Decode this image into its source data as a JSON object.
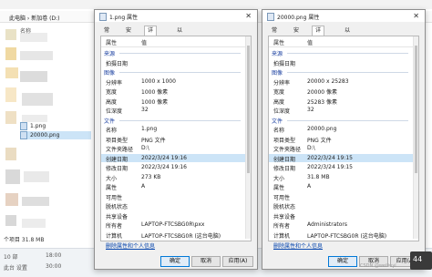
{
  "explorer": {
    "title": "",
    "breadcrumb": "此电脑 › 新加卷 (D:)",
    "column_name": "名称",
    "files": [
      {
        "name": "1.png",
        "selected": false
      },
      {
        "name": "20000.png",
        "selected": true
      }
    ],
    "status": "个项目  31.8 MB",
    "bottom_left_1": "10 部",
    "bottom_left_2": "此台 设置",
    "bottom_times": [
      "18:00",
      "30:00"
    ],
    "tray_text": "44"
  },
  "dialog1": {
    "title": "1.png 属性",
    "tabs": [
      "常规",
      "安全",
      "详细信息",
      "以前的版本"
    ],
    "active_tab": "详细信息",
    "header_property": "属性",
    "header_value": "值",
    "rows": [
      {
        "k": "来源",
        "v": "",
        "section": true
      },
      {
        "k": "拍摄日期",
        "v": ""
      },
      {
        "k": "图像",
        "v": "",
        "section": true
      },
      {
        "k": "分辨率",
        "v": "1000 x 1000"
      },
      {
        "k": "宽度",
        "v": "1000 像素"
      },
      {
        "k": "高度",
        "v": "1000 像素"
      },
      {
        "k": "位深度",
        "v": "32"
      },
      {
        "k": "文件",
        "v": "",
        "section": true
      },
      {
        "k": "名称",
        "v": "1.png"
      },
      {
        "k": "项目类型",
        "v": "PNG 文件"
      },
      {
        "k": "文件夹路径",
        "v": "D:\\"
      },
      {
        "k": "创建日期",
        "v": "2022/3/24 19:16",
        "hl": true
      },
      {
        "k": "修改日期",
        "v": "2022/3/24 19:16"
      },
      {
        "k": "大小",
        "v": "273 KB"
      },
      {
        "k": "属性",
        "v": "A"
      },
      {
        "k": "可用性",
        "v": ""
      },
      {
        "k": "脱机状态",
        "v": ""
      },
      {
        "k": "共享设备",
        "v": ""
      },
      {
        "k": "所有者",
        "v": "LAPTOP-FTCSBG0R\\pxx"
      },
      {
        "k": "计算机",
        "v": "LAPTOP-FTCSBG0R (这台电脑)"
      }
    ],
    "link": "删除属性和个人信息",
    "ok": "确定",
    "cancel": "取消",
    "apply": "应用(A)"
  },
  "dialog2": {
    "title": "20000.png 属性",
    "tabs": [
      "常规",
      "安全",
      "详细信息",
      "以前的版本"
    ],
    "active_tab": "详细信息",
    "header_property": "属性",
    "header_value": "值",
    "rows": [
      {
        "k": "来源",
        "v": "",
        "section": true
      },
      {
        "k": "拍摄日期",
        "v": ""
      },
      {
        "k": "图像",
        "v": "",
        "section": true
      },
      {
        "k": "分辨率",
        "v": "20000 x 25283"
      },
      {
        "k": "宽度",
        "v": "20000 像素"
      },
      {
        "k": "高度",
        "v": "25283 像素"
      },
      {
        "k": "位深度",
        "v": "32"
      },
      {
        "k": "文件",
        "v": "",
        "section": true
      },
      {
        "k": "名称",
        "v": "20000.png"
      },
      {
        "k": "项目类型",
        "v": "PNG 文件"
      },
      {
        "k": "文件夹路径",
        "v": "D:\\"
      },
      {
        "k": "创建日期",
        "v": "2022/3/24 19:15",
        "hl": true
      },
      {
        "k": "修改日期",
        "v": "2022/3/24 19:15"
      },
      {
        "k": "大小",
        "v": "31.8 MB"
      },
      {
        "k": "属性",
        "v": "A"
      },
      {
        "k": "可用性",
        "v": ""
      },
      {
        "k": "脱机状态",
        "v": ""
      },
      {
        "k": "共享设备",
        "v": ""
      },
      {
        "k": "所有者",
        "v": "Administrators"
      },
      {
        "k": "计算机",
        "v": "LAPTOP-FTCSBG0R (这台电脑)"
      }
    ],
    "link": "删除属性和个人信息",
    "ok": "确定",
    "cancel": "取消",
    "apply": "应用(A)"
  },
  "watermark": "CSDN @weiliuyi"
}
